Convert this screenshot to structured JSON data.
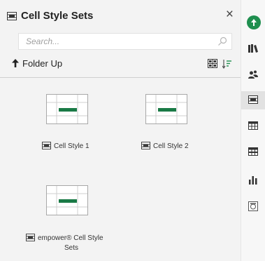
{
  "panel": {
    "title": "Cell Style Sets",
    "close_label": "×",
    "search": {
      "placeholder": "Search...",
      "value": ""
    },
    "toolbar": {
      "folder_up_label": "Folder Up"
    },
    "items": [
      {
        "label": "Cell Style 1"
      },
      {
        "label": "Cell Style 2"
      },
      {
        "label_line1": "empower® Cell Style",
        "label_line2": "Sets"
      }
    ]
  },
  "rail": {
    "icons": [
      "empower-logo-icon",
      "library-icon",
      "users-icon",
      "cell-style-icon",
      "table-icon",
      "table-layout-icon",
      "chart-icon",
      "image-icon"
    ],
    "active_index": 3
  },
  "colors": {
    "accent": "#1f8f4f",
    "thumb_bar": "#1a7a46"
  }
}
